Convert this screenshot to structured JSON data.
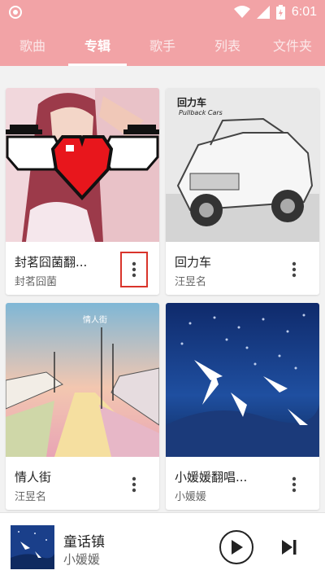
{
  "status_bar": {
    "time": "6:01"
  },
  "tabs": [
    {
      "label": "歌曲"
    },
    {
      "label": "专辑",
      "active": true
    },
    {
      "label": "歌手"
    },
    {
      "label": "列表"
    },
    {
      "label": "文件夹"
    }
  ],
  "albums": [
    {
      "title": "封茗囧菌翻...",
      "artist": "封茗囧菌",
      "more_highlighted": true
    },
    {
      "title": "回力车",
      "artist": "汪昱名",
      "cover_text": "Pullback Cars"
    },
    {
      "title": "情人街",
      "artist": "汪昱名",
      "cover_text": "情人街"
    },
    {
      "title": "小媛媛翻唱...",
      "artist": "小媛媛"
    }
  ],
  "now_playing": {
    "song": "童话镇",
    "artist": "小媛媛"
  },
  "colors": {
    "accent": "#f2a3a6",
    "highlight_box": "#d9342b"
  }
}
